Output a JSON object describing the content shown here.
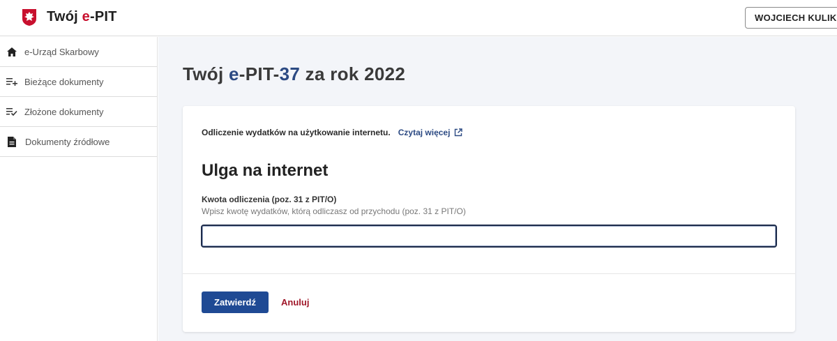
{
  "header": {
    "app_title_prefix": "Twój ",
    "app_title_accent": "e",
    "app_title_suffix": "-PIT",
    "user_button": "WOJCIECH KULIK"
  },
  "sidebar": {
    "items": [
      {
        "label": "e-Urząd Skarbowy",
        "icon": "home-icon"
      },
      {
        "label": "Bieżące dokumenty",
        "icon": "list-add-icon"
      },
      {
        "label": "Złożone dokumenty",
        "icon": "list-check-icon"
      },
      {
        "label": "Dokumenty źródłowe",
        "icon": "document-icon"
      }
    ]
  },
  "main": {
    "title_prefix": "Twój ",
    "title_e": "e",
    "title_pit": "-PIT-",
    "title_number": "37",
    "title_suffix": " za rok 2022",
    "card": {
      "info_text": "Odliczenie wydatków na użytkowanie internetu.",
      "info_link": "Czytaj więcej",
      "section_title": "Ulga na internet",
      "field_label": "Kwota odliczenia (poz. 31 z PIT/O)",
      "field_hint": "Wpisz kwotę wydatków, którą odliczasz od przychodu (poz. 31 z PIT/O)",
      "field_value": "",
      "submit_label": "Zatwierdź",
      "cancel_label": "Anuluj"
    }
  },
  "colors": {
    "brand_blue": "#1f4a94",
    "accent_red": "#c8102e",
    "cancel_red": "#a0182a"
  }
}
